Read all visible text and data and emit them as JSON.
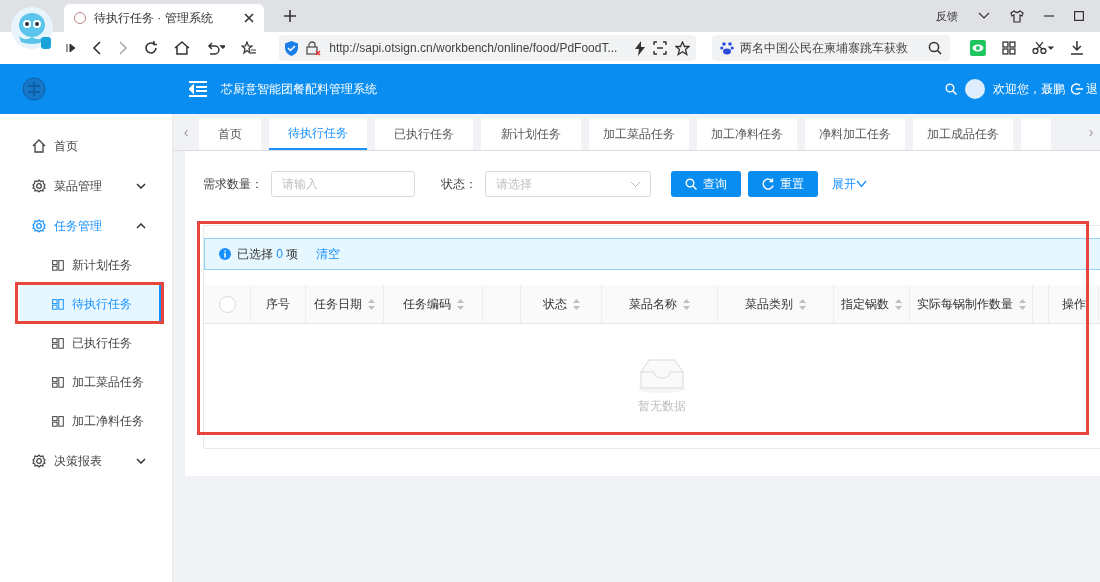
{
  "browser": {
    "tab_title": "待执行任务 · 管理系统",
    "url": "http://sapi.otsign.cn/workbench/online/food/PdFoodT...",
    "search_text": "两名中国公民在柬埔寨跳车获救",
    "feedback": "反馈"
  },
  "header": {
    "title": "芯厨意智能团餐配料管理系统",
    "greeting": "欢迎您，聂鹏",
    "logout": "退"
  },
  "sidebar": {
    "items": [
      {
        "label": "首页",
        "kind": "home"
      },
      {
        "label": "菜品管理",
        "kind": "group",
        "expanded": false,
        "selected": false
      },
      {
        "label": "任务管理",
        "kind": "group",
        "expanded": true,
        "selected": true,
        "children": [
          {
            "label": "新计划任务",
            "selected": false
          },
          {
            "label": "待执行任务",
            "selected": true
          },
          {
            "label": "已执行任务",
            "selected": false
          },
          {
            "label": "加工菜品任务",
            "selected": false
          },
          {
            "label": "加工净料任务",
            "selected": false
          }
        ]
      },
      {
        "label": "决策报表",
        "kind": "group",
        "expanded": false,
        "selected": false
      }
    ]
  },
  "tab_scroll": {
    "left": "‹",
    "right": "›"
  },
  "tabs": [
    {
      "label": "首页",
      "selected": false
    },
    {
      "label": "待执行任务",
      "selected": true
    },
    {
      "label": "已执行任务",
      "selected": false
    },
    {
      "label": "新计划任务",
      "selected": false
    },
    {
      "label": "加工菜品任务",
      "selected": false
    },
    {
      "label": "加工净料任务",
      "selected": false
    },
    {
      "label": "净料加工任务",
      "selected": false
    },
    {
      "label": "加工成品任务",
      "selected": false
    }
  ],
  "filters": [
    {
      "label": "需求数量：",
      "placeholder": "请输入",
      "kind": "input"
    },
    {
      "label": "状态：",
      "placeholder": "请选择",
      "kind": "select"
    }
  ],
  "buttons": [
    {
      "label": "查询",
      "kind": "search"
    },
    {
      "label": "重置",
      "kind": "reset"
    }
  ],
  "expand_link": "展开",
  "selection": {
    "prefix": "已选择",
    "count": "0",
    "suffix": "项",
    "clear": "清空"
  },
  "table": {
    "columns": [
      {
        "kind": "check",
        "checked": false
      },
      {
        "label": "序号",
        "sortable": false
      },
      {
        "label": "任务日期",
        "sortable": true
      },
      {
        "label": "任务编码",
        "sortable": true
      },
      {
        "kind": "blank"
      },
      {
        "label": "状态",
        "sortable": true
      },
      {
        "label": "菜品名称",
        "sortable": true
      },
      {
        "label": "菜品类别",
        "sortable": true
      },
      {
        "label": "指定锅数",
        "sortable": true
      },
      {
        "label": "实际每锅制作数量",
        "sortable": true
      },
      {
        "kind": "blank"
      },
      {
        "label": "操作",
        "sortable": false
      }
    ],
    "empty_text": "暂无数据"
  }
}
